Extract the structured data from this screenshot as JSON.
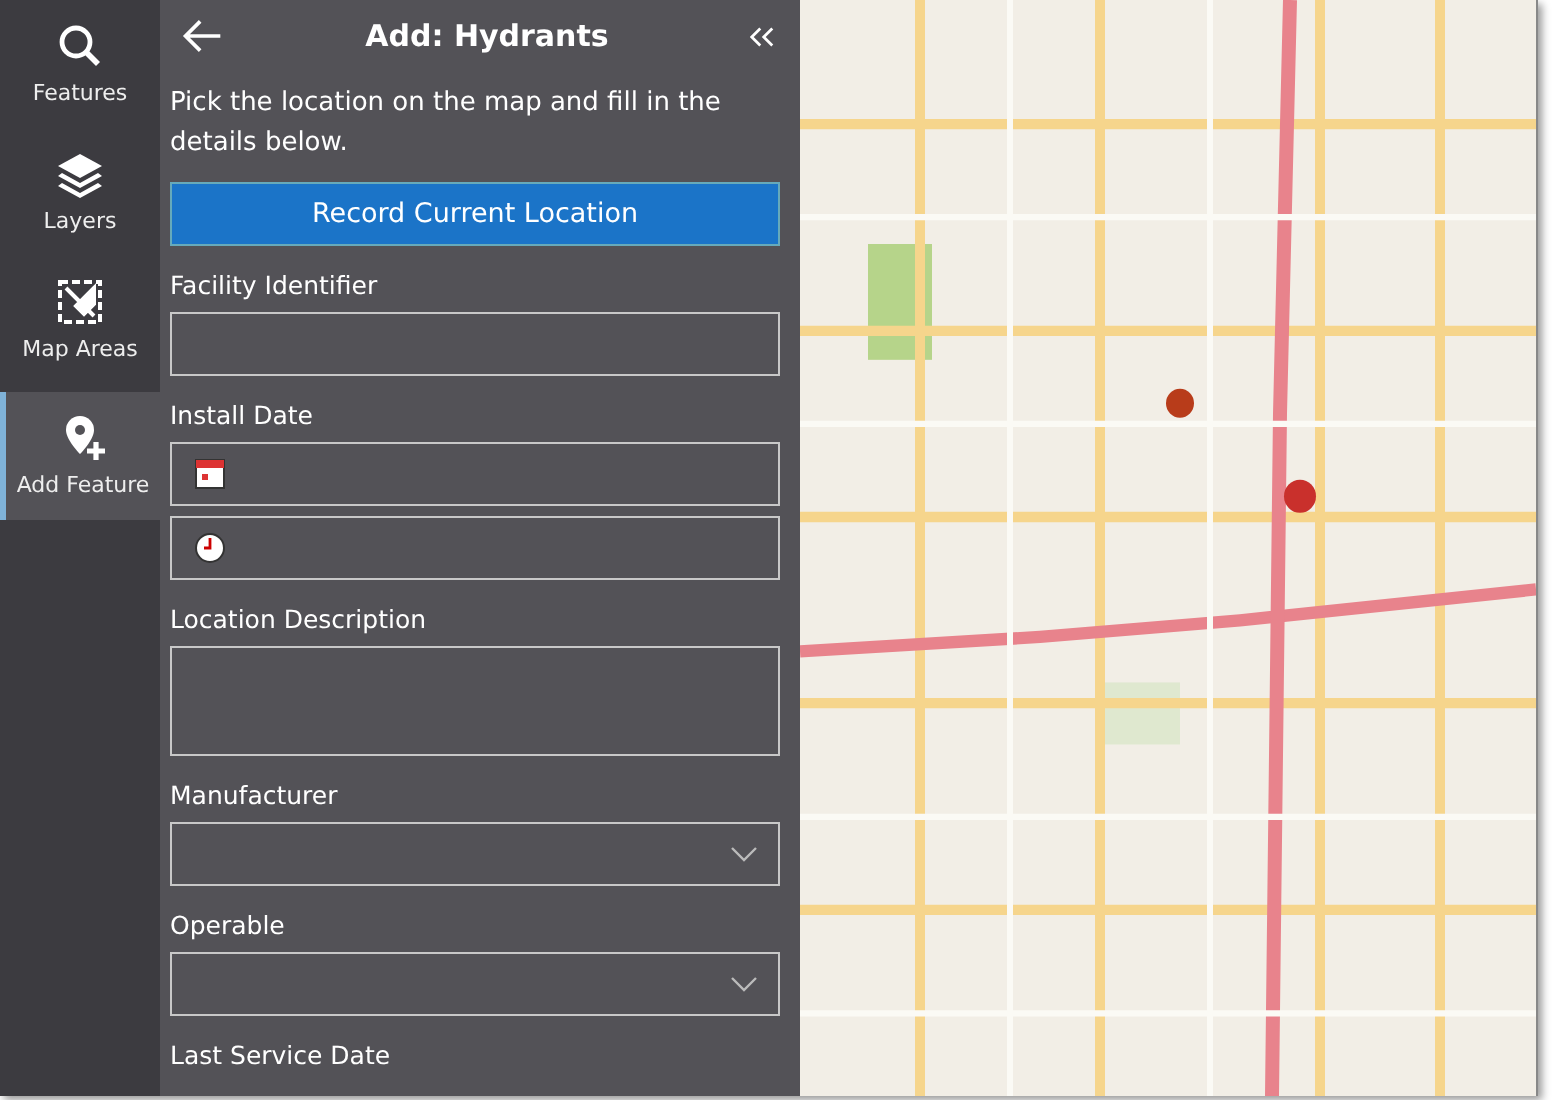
{
  "sidebar": {
    "items": [
      {
        "label": "Features",
        "kind": "search",
        "selected": false
      },
      {
        "label": "Layers",
        "kind": "layers",
        "selected": false
      },
      {
        "label": "Map Areas",
        "kind": "areas",
        "selected": false
      },
      {
        "label": "Add Feature",
        "kind": "add",
        "selected": true
      }
    ]
  },
  "panel": {
    "title": "Add: Hydrants",
    "instruction": "Pick the location on the map and fill in the details below.",
    "record_button": "Record Current Location",
    "fields": [
      {
        "kind": "text",
        "label": "Facility Identifier"
      },
      {
        "kind": "datetime",
        "label": "Install Date"
      },
      {
        "kind": "textarea",
        "label": "Location Description"
      },
      {
        "kind": "dropdown",
        "label": "Manufacturer"
      },
      {
        "kind": "dropdown",
        "label": "Operable"
      },
      {
        "kind": "label",
        "label": "Last Service Date"
      }
    ]
  }
}
